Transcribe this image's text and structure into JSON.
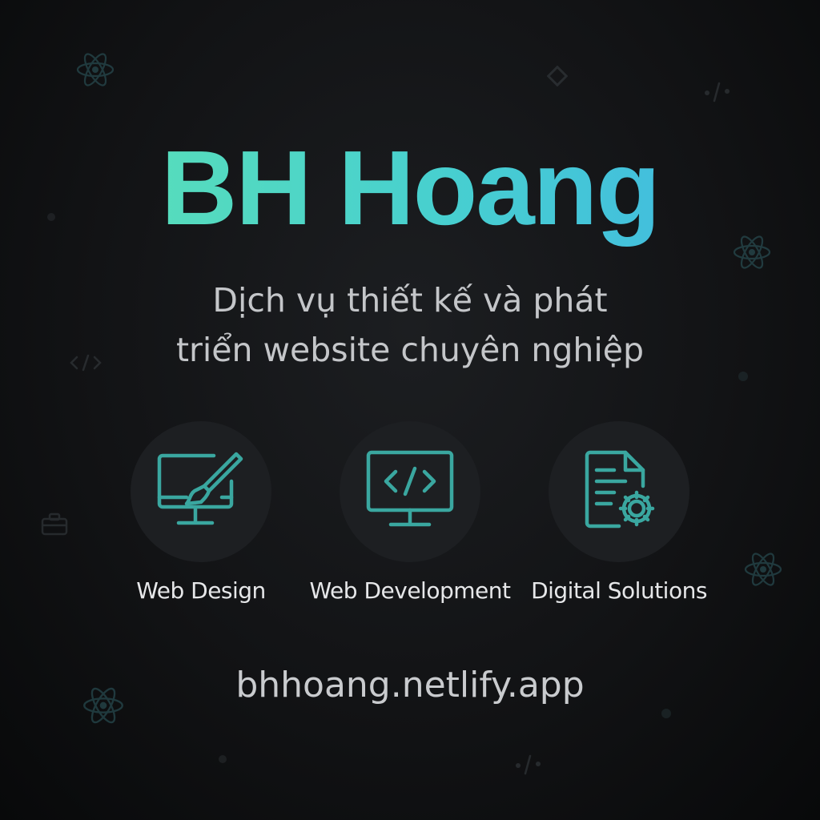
{
  "brand": {
    "name": "BH Hoang",
    "gradient": [
      "#5ee3b2",
      "#3fb3e6"
    ]
  },
  "tagline": {
    "line1": "Dịch vụ thiết kế và phát",
    "line2": "triển website chuyên nghiệp"
  },
  "services": [
    {
      "label": "Web Design",
      "icon": "monitor-brush-icon"
    },
    {
      "label": "Web Development",
      "icon": "monitor-code-icon"
    },
    {
      "label": "Digital Solutions",
      "icon": "document-gear-icon"
    }
  ],
  "website": "bhhoang.netlify.app",
  "colors": {
    "background": "#0c0d0f",
    "icon_accent": "#3aa7a0",
    "text_muted": "#c4c6c9"
  },
  "background_icons": [
    "react-atom-icon",
    "code-tag-icon",
    "diamond-icon",
    "briefcase-icon"
  ]
}
